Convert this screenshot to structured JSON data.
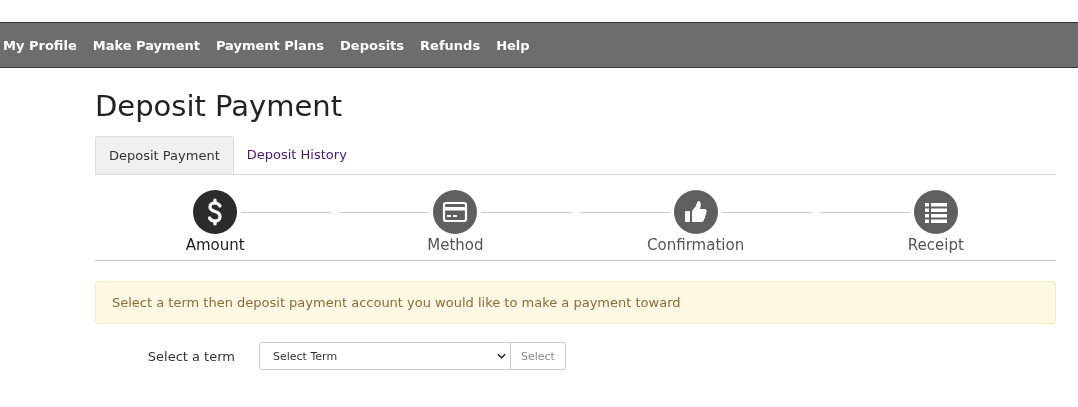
{
  "nav": [
    "My Profile",
    "Make Payment",
    "Payment Plans",
    "Deposits",
    "Refunds",
    "Help"
  ],
  "title": "Deposit Payment",
  "tabs": [
    {
      "label": "Deposit Payment",
      "selected": true
    },
    {
      "label": "Deposit History",
      "selected": false
    }
  ],
  "steps": [
    {
      "label": "Amount",
      "kind": "dollar",
      "selected": true
    },
    {
      "label": "Method",
      "kind": "card",
      "selected": false
    },
    {
      "label": "Confirmation",
      "kind": "thumb",
      "selected": false
    },
    {
      "label": "Receipt",
      "kind": "list",
      "selected": false
    }
  ],
  "alert": "Select a term then deposit payment account you would like to make a payment toward",
  "term": {
    "label": "Select a term",
    "placeholder": "Select Term",
    "button": "Select"
  }
}
